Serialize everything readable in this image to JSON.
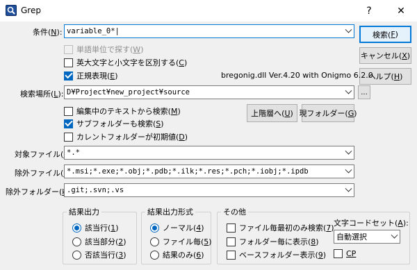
{
  "window": {
    "title": "Grep",
    "help_button": "?",
    "close_button": "✕"
  },
  "search": {
    "label_main": "条件(",
    "label_key": "N",
    "label_end": "):",
    "value": "variable_0*|"
  },
  "options": {
    "word_unit": {
      "main": "単語単位で探す(",
      "key": "W",
      "end": ")",
      "checked": false,
      "disabled": true
    },
    "case_sensitive": {
      "main": "英大文字と小文字を区別する(",
      "key": "C",
      "end": ")",
      "checked": false
    },
    "regex": {
      "main": "正規表現(",
      "key": "E",
      "end": ")",
      "checked": true
    }
  },
  "regex_lib": "bregonig.dll Ver.4.20 with Onigmo 6.2.0",
  "location": {
    "label_main": "検索場所(",
    "label_key": "L",
    "label_end": "):",
    "value": "D¥Project¥new_project¥source",
    "browse_label": "..."
  },
  "folder_options": {
    "editing_text": {
      "main": "編集中のテキストから検索(",
      "key": "M",
      "end": ")",
      "checked": false
    },
    "subfolders": {
      "main": "サブフォルダーも検索(",
      "key": "S",
      "end": ")",
      "checked": true
    },
    "current_folder": {
      "main": "カレントフォルダーが初期値(",
      "key": "D",
      "end": ")",
      "checked": false
    }
  },
  "buttons": {
    "search": {
      "main": "検索(",
      "key": "F",
      "end": ")"
    },
    "cancel": {
      "main": "キャンセル(",
      "key": "X",
      "end": ")"
    },
    "help": {
      "main": "ヘルプ(",
      "key": "H",
      "end": ")"
    },
    "parent": {
      "main": "上階層へ(",
      "key": "U",
      "end": ")"
    },
    "current": {
      "main": "現フォルダー(",
      "key": "G",
      "end": ")"
    }
  },
  "target_files": {
    "label_main": "対象ファイル(",
    "label_key": "I",
    "label_end": "):",
    "value": "*.*"
  },
  "exclude_files": {
    "label_main": "除外ファイル(",
    "label_key": "I",
    "label_end": "):",
    "value": "*.msi;*.exe;*.obj;*.pdb;*.ilk;*.res;*.pch;*.iobj;*.ipdb"
  },
  "exclude_folders": {
    "label_main": "除外フォルダー(",
    "label_key": "k",
    "label_end": "):",
    "value": ".git;.svn;.vs"
  },
  "output": {
    "title": "結果出力",
    "items": [
      {
        "main": "該当行(",
        "key": "1",
        "end": ")",
        "selected": true
      },
      {
        "main": "該当部分(",
        "key": "2",
        "end": ")",
        "selected": false
      },
      {
        "main": "否該当行(",
        "key": "3",
        "end": ")",
        "selected": false
      }
    ]
  },
  "format": {
    "title": "結果出力形式",
    "items": [
      {
        "main": "ノーマル(",
        "key": "4",
        "end": ")",
        "selected": true
      },
      {
        "main": "ファイル毎(",
        "key": "5",
        "end": ")",
        "selected": false
      },
      {
        "main": "結果のみ(",
        "key": "6",
        "end": ")",
        "selected": false
      }
    ]
  },
  "misc": {
    "title": "その他",
    "items": [
      {
        "main": "ファイル毎最初のみ検索(",
        "key": "7",
        "end": ")",
        "checked": false
      },
      {
        "main": "フォルダー毎に表示(",
        "key": "8",
        "end": ")",
        "checked": false
      },
      {
        "main": "ベースフォルダー表示(",
        "key": "9",
        "end": ")",
        "checked": false
      }
    ]
  },
  "charset": {
    "label_main": "文字コードセット(",
    "label_key": "A",
    "label_end": "):",
    "value": "自動選択",
    "cp_label": "CP",
    "cp_checked": false
  },
  "icons": {
    "app": "grep-magnifier-icon",
    "dropdown": "chevron-down-icon"
  },
  "colors": {
    "accent": "#0078d7",
    "check": "#0067c0"
  }
}
